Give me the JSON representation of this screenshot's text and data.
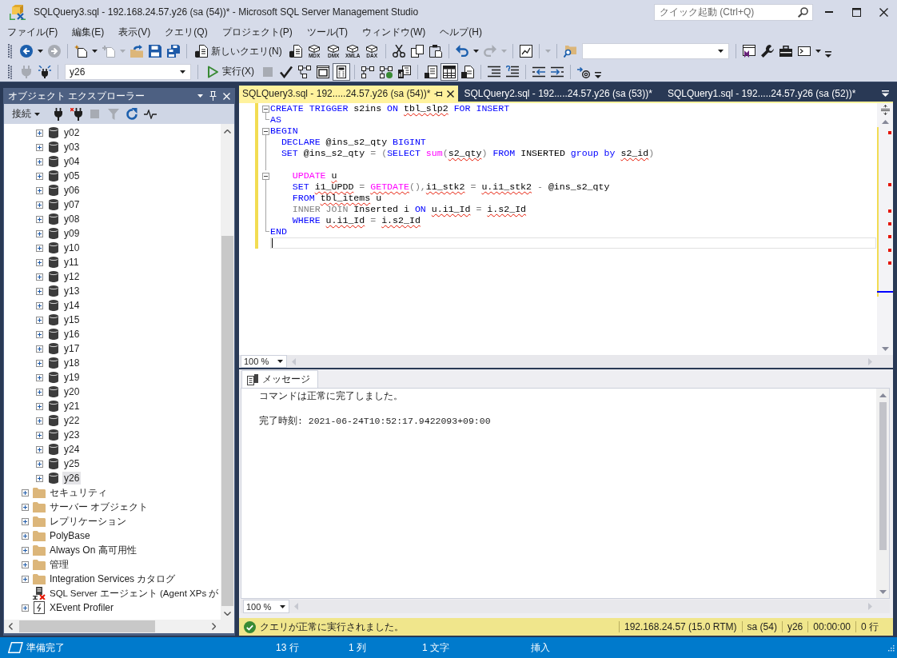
{
  "window": {
    "title": "SQLQuery3.sql - 192.168.24.57.y26 (sa (54))* - Microsoft SQL Server Management Studio",
    "quick_launch": {
      "placeholder": "クイック起動 (Ctrl+Q)"
    }
  },
  "menu": [
    "ファイル(F)",
    "編集(E)",
    "表示(V)",
    "クエリ(Q)",
    "プロジェクト(P)",
    "ツール(T)",
    "ウィンドウ(W)",
    "ヘルプ(H)"
  ],
  "toolbar_1": [
    {
      "kind": "button",
      "disabled": false
    },
    {
      "kind": "caret",
      "disabled": false
    },
    {
      "kind": "button",
      "disabled": true
    },
    {
      "kind": "separator"
    },
    {
      "kind": "button",
      "disabled": false
    },
    {
      "kind": "caret",
      "disabled": false
    },
    {
      "kind": "button",
      "disabled": true
    },
    {
      "kind": "caret",
      "disabled": true
    },
    {
      "kind": "button",
      "disabled": false
    },
    {
      "kind": "button",
      "disabled": false
    },
    {
      "kind": "button",
      "disabled": false
    },
    {
      "kind": "separator"
    },
    {
      "kind": "label-button",
      "label": "新しいクエリ(N)",
      "disabled": false
    },
    {
      "kind": "button",
      "disabled": false
    },
    {
      "kind": "cube-button",
      "label": "MDX",
      "disabled": false
    },
    {
      "kind": "cube-button",
      "label": "DMX",
      "disabled": false
    },
    {
      "kind": "cube-button",
      "label": "XMLA",
      "disabled": false
    },
    {
      "kind": "cube-button",
      "label": "DAX",
      "disabled": false
    },
    {
      "kind": "separator"
    },
    {
      "kind": "button",
      "disabled": false
    },
    {
      "kind": "button",
      "disabled": false
    },
    {
      "kind": "button",
      "disabled": false
    },
    {
      "kind": "separator"
    },
    {
      "kind": "button",
      "disabled": false
    },
    {
      "kind": "caret",
      "disabled": false
    },
    {
      "kind": "button",
      "disabled": true
    },
    {
      "kind": "caret",
      "disabled": true
    },
    {
      "kind": "separator"
    },
    {
      "kind": "button",
      "disabled": false
    },
    {
      "kind": "separator"
    },
    {
      "kind": "caret",
      "disabled": true
    },
    {
      "kind": "separator"
    },
    {
      "kind": "button",
      "disabled": false
    },
    {
      "kind": "combo"
    },
    {
      "kind": "separator"
    },
    {
      "kind": "button",
      "disabled": false
    },
    {
      "kind": "button",
      "disabled": false
    },
    {
      "kind": "button",
      "disabled": false
    },
    {
      "kind": "button",
      "disabled": false
    },
    {
      "kind": "caret",
      "disabled": false
    },
    {
      "kind": "overflow"
    }
  ],
  "toolbar_2": [
    {
      "kind": "button",
      "disabled": true
    },
    {
      "kind": "button",
      "disabled": false
    },
    {
      "kind": "separator"
    },
    {
      "kind": "combo",
      "value": "y26"
    },
    {
      "kind": "separator"
    },
    {
      "kind": "label-button",
      "label": "実行(X)",
      "disabled": false
    },
    {
      "kind": "button",
      "disabled": true
    },
    {
      "kind": "button",
      "disabled": false
    },
    {
      "kind": "button",
      "disabled": false
    },
    {
      "kind": "button",
      "disabled": false
    },
    {
      "kind": "toggle",
      "disabled": false,
      "pressed": true
    },
    {
      "kind": "separator"
    },
    {
      "kind": "toggle",
      "disabled": false,
      "pressed": false
    },
    {
      "kind": "toggle",
      "disabled": false,
      "pressed": false
    },
    {
      "kind": "toggle",
      "disabled": false,
      "pressed": false
    },
    {
      "kind": "separator"
    },
    {
      "kind": "toggle",
      "disabled": false,
      "pressed": false
    },
    {
      "kind": "toggle",
      "disabled": false,
      "pressed": true
    },
    {
      "kind": "toggle",
      "disabled": false,
      "pressed": false
    },
    {
      "kind": "separator"
    },
    {
      "kind": "button",
      "disabled": false
    },
    {
      "kind": "button",
      "disabled": false
    },
    {
      "kind": "separator"
    },
    {
      "kind": "button",
      "disabled": false
    },
    {
      "kind": "button",
      "disabled": false
    },
    {
      "kind": "separator"
    },
    {
      "kind": "button",
      "disabled": false
    },
    {
      "kind": "overflow"
    }
  ],
  "object_explorer": {
    "title": "オブジェクト エクスプローラー",
    "connect_button": {
      "label": "接続"
    },
    "tools": [
      {
        "disabled": false
      },
      {
        "disabled": false
      },
      {
        "disabled": true
      },
      {
        "disabled": true
      },
      {
        "disabled": false
      },
      {
        "disabled": false
      }
    ],
    "tree": [
      {
        "children": [
          {
            "label": "y02",
            "kind": "database",
            "expandable": true,
            "selected": false
          },
          {
            "label": "y03",
            "kind": "database",
            "expandable": true,
            "selected": false
          },
          {
            "label": "y04",
            "kind": "database",
            "expandable": true,
            "selected": false
          },
          {
            "label": "y05",
            "kind": "database",
            "expandable": true,
            "selected": false
          },
          {
            "label": "y06",
            "kind": "database",
            "expandable": true,
            "selected": false
          },
          {
            "label": "y07",
            "kind": "database",
            "expandable": true,
            "selected": false
          },
          {
            "label": "y08",
            "kind": "database",
            "expandable": true,
            "selected": false
          },
          {
            "label": "y09",
            "kind": "database",
            "expandable": true,
            "selected": false
          },
          {
            "label": "y10",
            "kind": "database",
            "expandable": true,
            "selected": false
          },
          {
            "label": "y11",
            "kind": "database",
            "expandable": true,
            "selected": false
          },
          {
            "label": "y12",
            "kind": "database",
            "expandable": true,
            "selected": false
          },
          {
            "label": "y13",
            "kind": "database",
            "expandable": true,
            "selected": false
          },
          {
            "label": "y14",
            "kind": "database",
            "expandable": true,
            "selected": false
          },
          {
            "label": "y15",
            "kind": "database",
            "expandable": true,
            "selected": false
          },
          {
            "label": "y16",
            "kind": "database",
            "expandable": true,
            "selected": false
          },
          {
            "label": "y17",
            "kind": "database",
            "expandable": true,
            "selected": false
          },
          {
            "label": "y18",
            "kind": "database",
            "expandable": true,
            "selected": false
          },
          {
            "label": "y19",
            "kind": "database",
            "expandable": true,
            "selected": false
          },
          {
            "label": "y20",
            "kind": "database",
            "expandable": true,
            "selected": false
          },
          {
            "label": "y21",
            "kind": "database",
            "expandable": true,
            "selected": false
          },
          {
            "label": "y22",
            "kind": "database",
            "expandable": true,
            "selected": false
          },
          {
            "label": "y23",
            "kind": "database",
            "expandable": true,
            "selected": false
          },
          {
            "label": "y24",
            "kind": "database",
            "expandable": true,
            "selected": false
          },
          {
            "label": "y25",
            "kind": "database",
            "expandable": true,
            "selected": false
          },
          {
            "label": "y26",
            "kind": "database",
            "expandable": true,
            "selected": true
          }
        ]
      },
      {
        "label": "セキュリティ",
        "kind": "folder",
        "expandable": true,
        "selected": false
      },
      {
        "label": "サーバー オブジェクト",
        "kind": "folder",
        "expandable": true,
        "selected": false
      },
      {
        "label": "レプリケーション",
        "kind": "folder",
        "expandable": true,
        "selected": false
      },
      {
        "label": "PolyBase",
        "kind": "folder",
        "expandable": true,
        "selected": false
      },
      {
        "label": "Always On 高可用性",
        "kind": "folder",
        "expandable": true,
        "selected": false
      },
      {
        "label": "管理",
        "kind": "folder",
        "expandable": true,
        "selected": false
      },
      {
        "label": "Integration Services カタログ",
        "kind": "folder",
        "expandable": true,
        "selected": false
      },
      {
        "label": "SQL Server エージェント (Agent XPs が",
        "kind": "agent",
        "expandable": false,
        "selected": false
      },
      {
        "label": "XEvent Profiler",
        "kind": "profiler",
        "expandable": true,
        "selected": false
      }
    ]
  },
  "editor": {
    "tabs": [
      {
        "label": "SQLQuery3.sql - 192.....24.57.y26 (sa (54))*",
        "selected": true
      },
      {
        "label": "SQLQuery2.sql - 192.....24.57.y26 (sa (53))*",
        "selected": false
      },
      {
        "label": "SQLQuery1.sql - 192.....24.57.y26 (sa (52))*",
        "selected": false
      }
    ],
    "lines": [
      {
        "kind": "start",
        "changed": true,
        "current": false,
        "tokens": [
          {
            "text": "CREATE TRIGGER",
            "kind": "keyword",
            "error": false
          },
          {
            "text": " s2ins",
            "kind": "text",
            "error": false
          },
          {
            "text": " ON ",
            "kind": "keyword",
            "error": false
          },
          {
            "text": "tbl_slp2",
            "kind": "text",
            "error": true
          },
          {
            "text": " FOR INSERT",
            "kind": "keyword",
            "error": false
          }
        ]
      },
      {
        "kind": "end",
        "changed": true,
        "current": false,
        "tokens": [
          {
            "text": "AS",
            "kind": "keyword",
            "error": false
          }
        ]
      },
      {
        "kind": "start",
        "changed": true,
        "current": false,
        "tokens": [
          {
            "text": "BEGIN",
            "kind": "keyword",
            "error": false
          }
        ]
      },
      {
        "kind": "inside",
        "changed": true,
        "current": false,
        "tokens": [
          {
            "text": "  DECLARE",
            "kind": "keyword",
            "error": false
          },
          {
            "text": " @ins_s2_qty",
            "kind": "text",
            "error": false
          },
          {
            "text": " BIGINT",
            "kind": "keyword",
            "error": false
          }
        ]
      },
      {
        "kind": "inside",
        "changed": true,
        "current": false,
        "tokens": [
          {
            "text": "  SET",
            "kind": "keyword",
            "error": false
          },
          {
            "text": " @ins_s2_qty ",
            "kind": "text",
            "error": false
          },
          {
            "text": "=",
            "kind": "operator",
            "error": false
          },
          {
            "text": " (",
            "kind": "operator",
            "error": false
          },
          {
            "text": "SELECT",
            "kind": "keyword",
            "error": false
          },
          {
            "text": " sum",
            "kind": "function",
            "error": false
          },
          {
            "text": "(",
            "kind": "operator",
            "error": false
          },
          {
            "text": "s2_qty",
            "kind": "text",
            "error": true
          },
          {
            "text": ")",
            "kind": "operator",
            "error": false
          },
          {
            "text": " FROM",
            "kind": "keyword",
            "error": false
          },
          {
            "text": " INSERTED ",
            "kind": "text",
            "error": false
          },
          {
            "text": "group by ",
            "kind": "keyword",
            "error": false
          },
          {
            "text": "s2_id",
            "kind": "text",
            "error": true
          },
          {
            "text": ")",
            "kind": "operator",
            "error": false
          }
        ]
      },
      {
        "kind": "inside",
        "changed": true,
        "current": false
      },
      {
        "kind": "start",
        "changed": true,
        "current": false,
        "tokens": [
          {
            "text": "    UPDATE ",
            "kind": "function",
            "error": false
          },
          {
            "text": "u",
            "kind": "text",
            "error": true
          }
        ]
      },
      {
        "kind": "inside",
        "changed": true,
        "current": false,
        "tokens": [
          {
            "text": "    SET ",
            "kind": "keyword",
            "error": false
          },
          {
            "text": "i1_UPDD",
            "kind": "text",
            "error": true
          },
          {
            "text": " = ",
            "kind": "operator",
            "error": false
          },
          {
            "text": "GETDATE",
            "kind": "function",
            "error": true
          },
          {
            "text": "(),",
            "kind": "operator",
            "error": false
          },
          {
            "text": "i1_stk2",
            "kind": "text",
            "error": true
          },
          {
            "text": " = ",
            "kind": "operator",
            "error": false
          },
          {
            "text": "u.i1_stk2",
            "kind": "text",
            "error": true
          },
          {
            "text": " - ",
            "kind": "operator",
            "error": false
          },
          {
            "text": "@ins_s2_qty",
            "kind": "text",
            "error": false
          }
        ]
      },
      {
        "kind": "inside",
        "changed": true,
        "current": false,
        "tokens": [
          {
            "text": "    FROM ",
            "kind": "keyword",
            "error": false
          },
          {
            "text": "tbl_items",
            "kind": "text",
            "error": true
          },
          {
            "text": " u",
            "kind": "text",
            "error": false
          }
        ]
      },
      {
        "kind": "inside",
        "changed": true,
        "current": false,
        "tokens": [
          {
            "text": "    INNER JOIN",
            "kind": "operator",
            "error": false
          },
          {
            "text": " Inserted i",
            "kind": "text",
            "error": false
          },
          {
            "text": " ON ",
            "kind": "keyword",
            "error": false
          },
          {
            "text": "u.i1_Id",
            "kind": "text",
            "error": true
          },
          {
            "text": " = ",
            "kind": "operator",
            "error": false
          },
          {
            "text": "i.s2_Id",
            "kind": "text",
            "error": true
          }
        ]
      },
      {
        "kind": "inside",
        "changed": true,
        "current": false,
        "tokens": [
          {
            "text": "    WHERE ",
            "kind": "keyword",
            "error": false
          },
          {
            "text": "u.i1_Id",
            "kind": "text",
            "error": true
          },
          {
            "text": " = ",
            "kind": "operator",
            "error": false
          },
          {
            "text": "i.s2_Id",
            "kind": "text",
            "error": true
          }
        ]
      },
      {
        "kind": "end",
        "changed": true,
        "current": false,
        "tokens": [
          {
            "text": "END",
            "kind": "keyword",
            "error": false
          }
        ]
      },
      {
        "kind": "plain",
        "changed": true,
        "current": true
      }
    ],
    "zoom": "100 %"
  },
  "results": {
    "tabs": [
      {
        "label": "メッセージ",
        "selected": true
      }
    ],
    "messages": [
      {
        "text": "コマンドは正常に完了しました。",
        "kind": "text"
      },
      {
        "text": "完了時刻: 2021-06-24T10:52:17.9422093+09:00",
        "kind": "mono"
      }
    ],
    "zoom": "100 %"
  },
  "query_status": {
    "message": "クエリが正常に実行されました。",
    "cells": [
      "192.168.24.57 (15.0 RTM)",
      "sa (54)",
      "y26",
      "00:00:00",
      "0 行"
    ]
  },
  "status_bar": {
    "state": "準備完了",
    "line": "13 行",
    "column": "1 列",
    "chars": "1 文字",
    "mode": "挿入"
  }
}
